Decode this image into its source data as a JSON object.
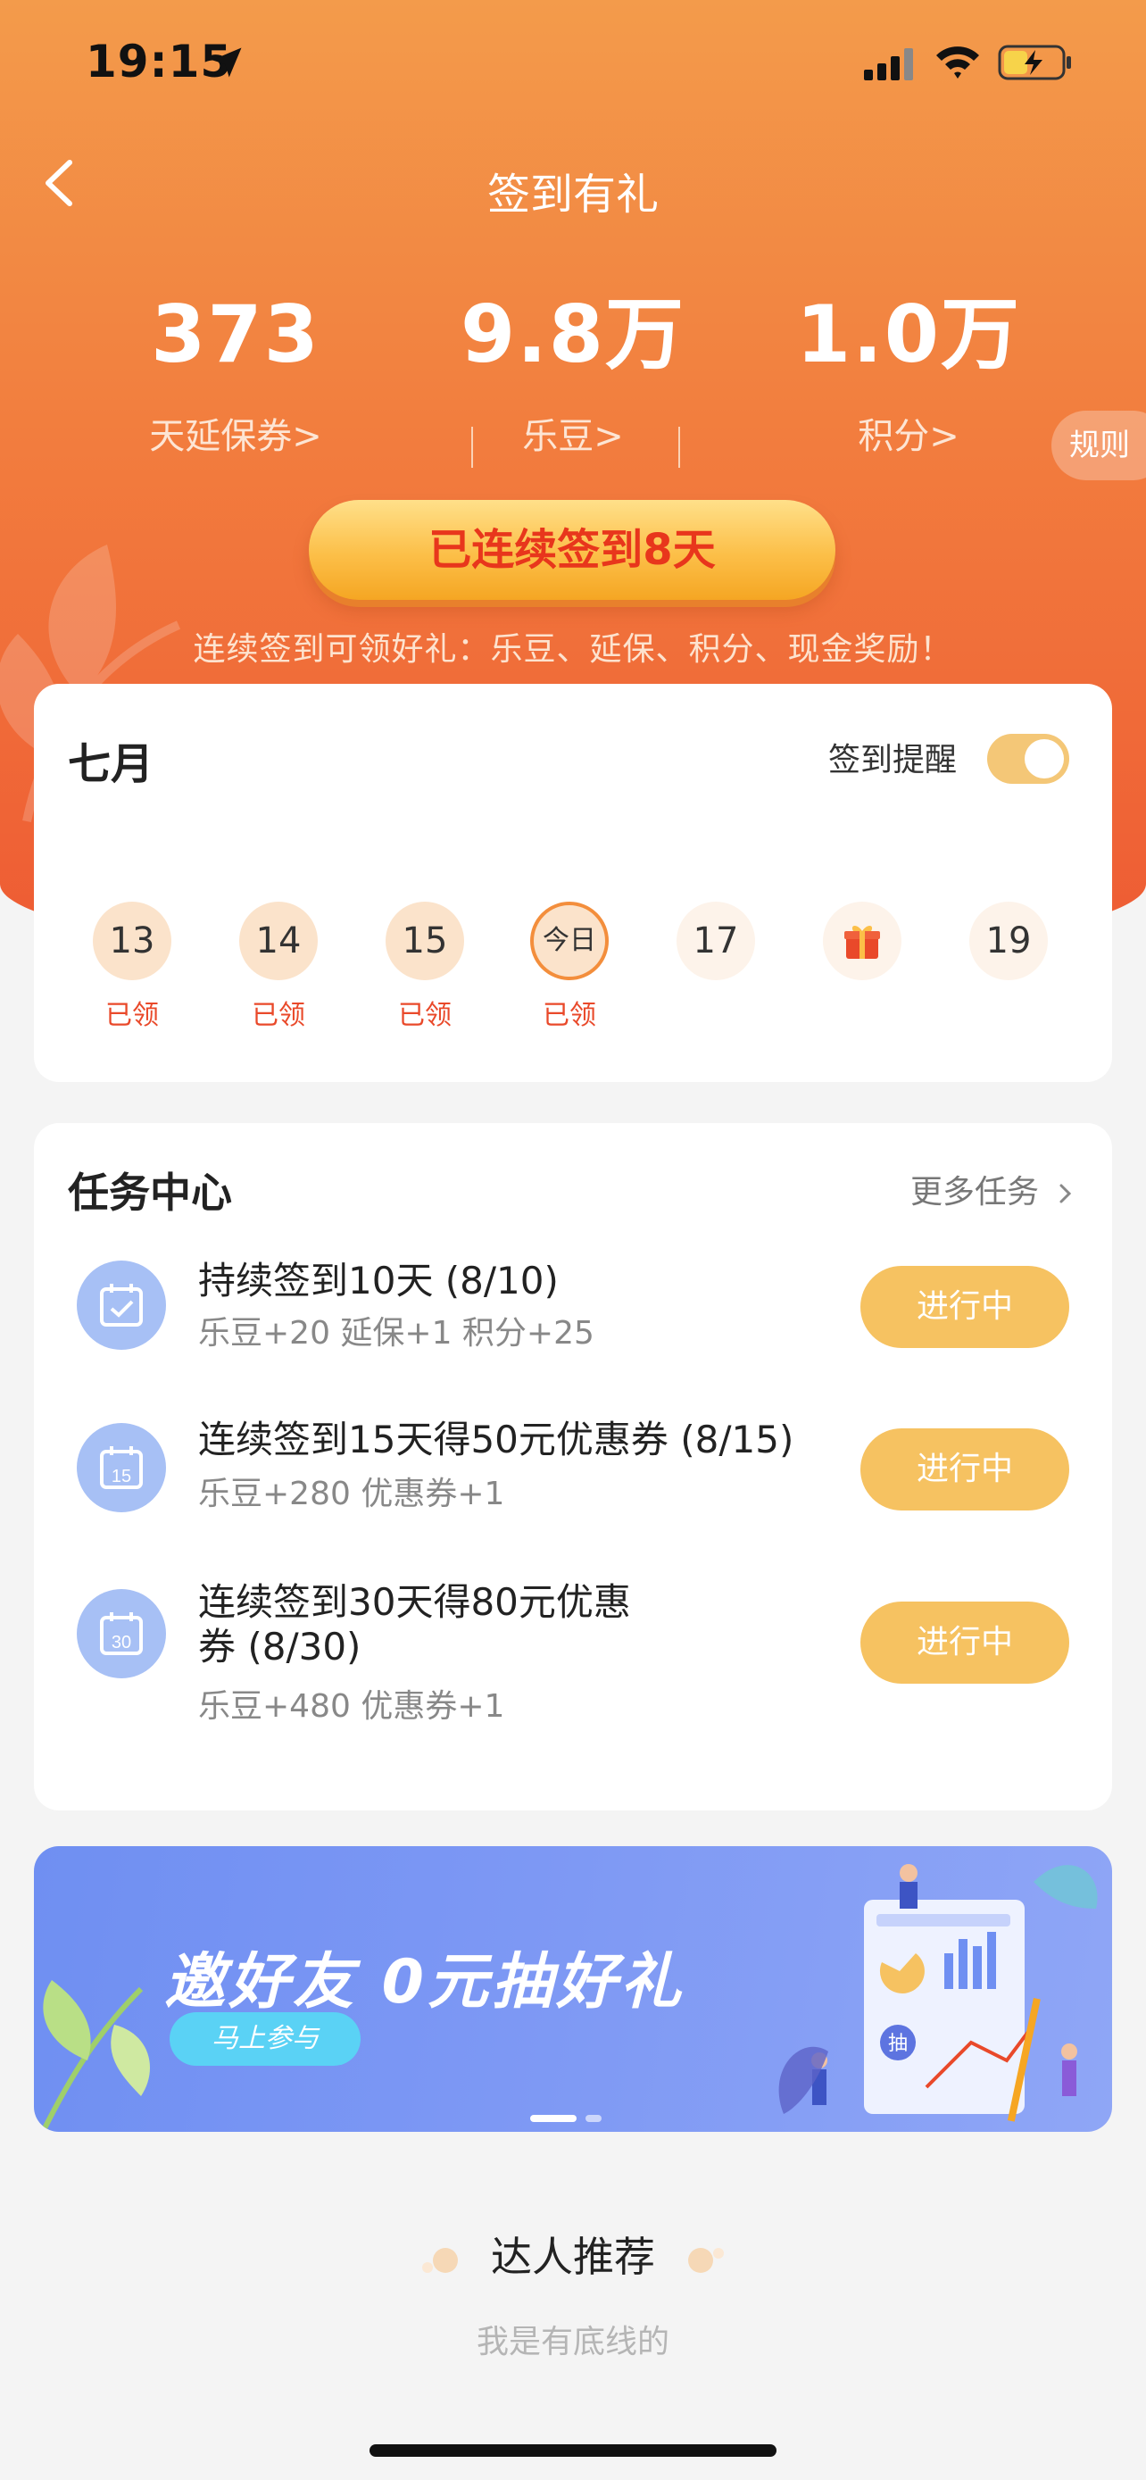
{
  "status_bar": {
    "time": "19:15"
  },
  "nav": {
    "title": "签到有礼"
  },
  "stats": [
    {
      "value": "373",
      "label": "天延保券>"
    },
    {
      "value": "9.8万",
      "label": "乐豆>"
    },
    {
      "value": "1.0万",
      "label": "积分>"
    }
  ],
  "rules_label": "规则",
  "streak": {
    "label": "已连续签到8天",
    "tip": "连续签到可领好礼：乐豆、延保、积分、现金奖励！"
  },
  "calendar": {
    "month": "七月",
    "reminder_label": "签到提醒",
    "reminder_on": true,
    "days": [
      {
        "label": "13",
        "status": "已领"
      },
      {
        "label": "14",
        "status": "已领"
      },
      {
        "label": "15",
        "status": "已领"
      },
      {
        "label": "今日",
        "status": "已领"
      },
      {
        "label": "17",
        "status": ""
      },
      {
        "label": "",
        "status": ""
      },
      {
        "label": "19",
        "status": ""
      }
    ]
  },
  "tasks": {
    "title": "任务中心",
    "more": "更多任务",
    "items": [
      {
        "name": "持续签到10天 (8/10)",
        "reward": "乐豆+20 延保+1 积分+25",
        "button": "进行中",
        "icon": "calendar-check-icon"
      },
      {
        "name": "连续签到15天得50元优惠券 (8/15)",
        "reward": "乐豆+280 优惠券+1",
        "button": "进行中",
        "icon": "calendar-15-icon",
        "icon_text": "15"
      },
      {
        "name_line1": "连续签到30天得80元优惠",
        "name_line2": "券 (8/30)",
        "reward": "乐豆+480 优惠券+1",
        "button": "进行中",
        "icon": "calendar-30-icon",
        "icon_text": "30"
      }
    ]
  },
  "banner": {
    "title": "邀好友 0元抽好礼",
    "cta": "马上参与",
    "art_badge": "抽",
    "slides": 2,
    "active_slide": 1
  },
  "recommend": {
    "title": "达人推荐",
    "subtitle": "我是有底线的"
  },
  "colors": {
    "hero_top": "#f39b4b",
    "hero_bottom": "#ee5a33",
    "accent_red": "#e9492a",
    "task_button": "#f6c261",
    "banner_bg": "#7d98f4"
  }
}
